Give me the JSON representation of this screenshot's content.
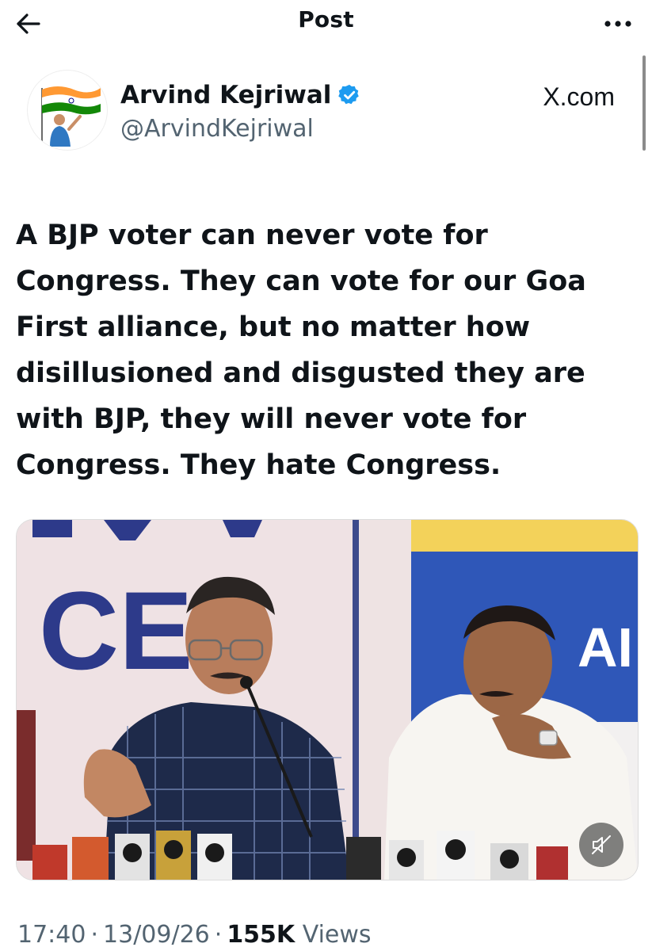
{
  "header": {
    "title": "Post",
    "back_icon": "arrow-left-icon",
    "more_icon": "more-horizontal-icon"
  },
  "author": {
    "display_name": "Arvind Kejriwal",
    "handle": "@ArvindKejriwal",
    "verified": true,
    "verified_color": "#1d9bf0",
    "avatar_icon": "avatar-flag-icon"
  },
  "watermark": "X.com",
  "post": {
    "lines": [
      "A BJP voter can never vote for",
      "Congress. They can vote for our Goa",
      "First alliance, but no matter how",
      "disillusioned and disgusted they are",
      "with BJP, they will never vote for",
      "Congress. They hate Congress."
    ]
  },
  "media": {
    "type": "video",
    "mute_icon": "volume-muted-icon",
    "backdrop_lettering": [
      "CE",
      "AI"
    ]
  },
  "meta": {
    "time": "17:40",
    "date": "13/09/26",
    "views_count": "155K",
    "views_label": "Views",
    "separator": "·"
  },
  "colors": {
    "text_primary": "#0f1419",
    "text_secondary": "#536471",
    "accent": "#1d9bf0"
  }
}
